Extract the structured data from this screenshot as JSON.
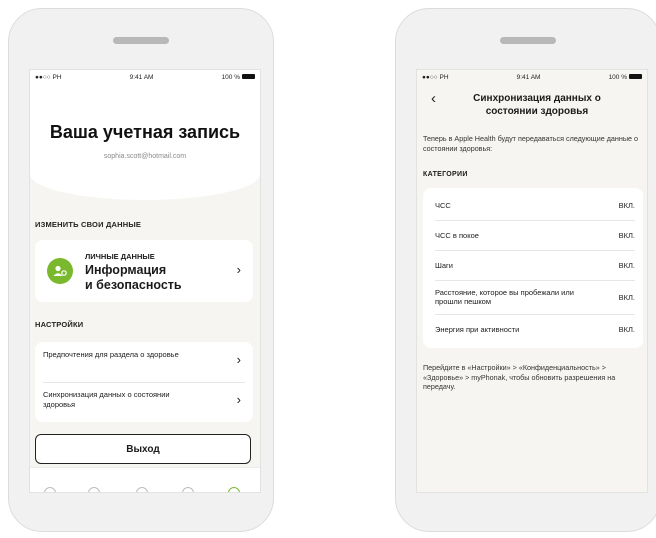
{
  "left_screen": {
    "status": {
      "carrier": "●●○○ PH",
      "time": "9:41 AM",
      "battery": "100 %"
    },
    "title": "Ваша учетная запись",
    "email": "sophia.scott@hotmail.com",
    "edit_section_label": "ИЗМЕНИТЬ СВОИ ДАННЫЕ",
    "personal_card": {
      "title": "ЛИЧНЫЕ ДАННЫЕ",
      "line1": "Информация",
      "line2": "и безопасность"
    },
    "settings_label": "НАСТРОЙКИ",
    "settings_items": [
      {
        "label": "Предпочтения для раздела о здоровье"
      },
      {
        "label": "Синхронизация данных о состоянии здоровья"
      }
    ],
    "logout_label": "Выход"
  },
  "right_screen": {
    "status": {
      "carrier": "●●○○ PH",
      "time": "9:41 AM",
      "battery": "100 %"
    },
    "title": "Синхронизация данных о состоянии здоровья",
    "intro": "Теперь в Apple Health будут передаваться следующие данные о состоянии здоровья:",
    "categories_label": "КАТЕГОРИИ",
    "categories": [
      {
        "label": "ЧСС",
        "value": "ВКЛ."
      },
      {
        "label": "ЧСС в покое",
        "value": "ВКЛ."
      },
      {
        "label": "Шаги",
        "value": "ВКЛ."
      },
      {
        "label": "Расстояние, которое вы пробежали или прошли пешком",
        "value": "ВКЛ."
      },
      {
        "label": "Энергия при активности",
        "value": "ВКЛ."
      }
    ],
    "footer_note": "Перейдите в «Настройки» > «Конфиденциальность» > «Здоровье» > myPhonak, чтобы обновить разрешения на передачу."
  },
  "colors": {
    "accent": "#7ab82e",
    "screen_bg": "#f6f5f1"
  }
}
